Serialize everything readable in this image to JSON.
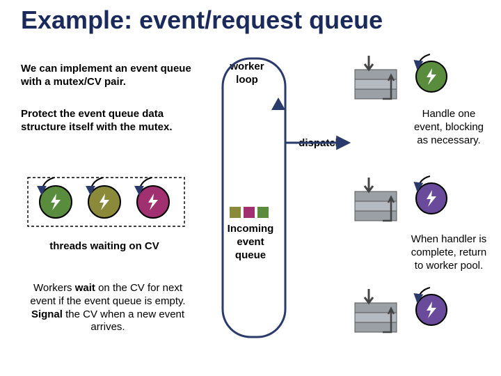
{
  "title": "Example: event/request queue",
  "left": {
    "p1": "We can implement an event queue with a mutex/CV pair.",
    "p2": "Protect the event queue data structure itself with the mutex.",
    "threads_label": "threads waiting on CV",
    "p3_html": "Workers <b>wait</b> on the CV for next event if the event queue is empty.  <b>Signal</b> the CV when a new event arrives."
  },
  "center": {
    "worker_loop": "worker\nloop",
    "dispatch": "dispatch",
    "incoming": "Incoming\nevent\nqueue"
  },
  "right": {
    "handle": "Handle one event, blocking as necessary.",
    "return": "When handler is complete, return to worker pool."
  },
  "colors": {
    "title": "#1a2a5a",
    "green": "#5a8c3e",
    "olive": "#8a8a3a",
    "magenta": "#a03070",
    "purple": "#6a4a9a",
    "grey": "#9aa0a6",
    "dgrey": "#7a8086",
    "navy": "#2a3a6a"
  }
}
